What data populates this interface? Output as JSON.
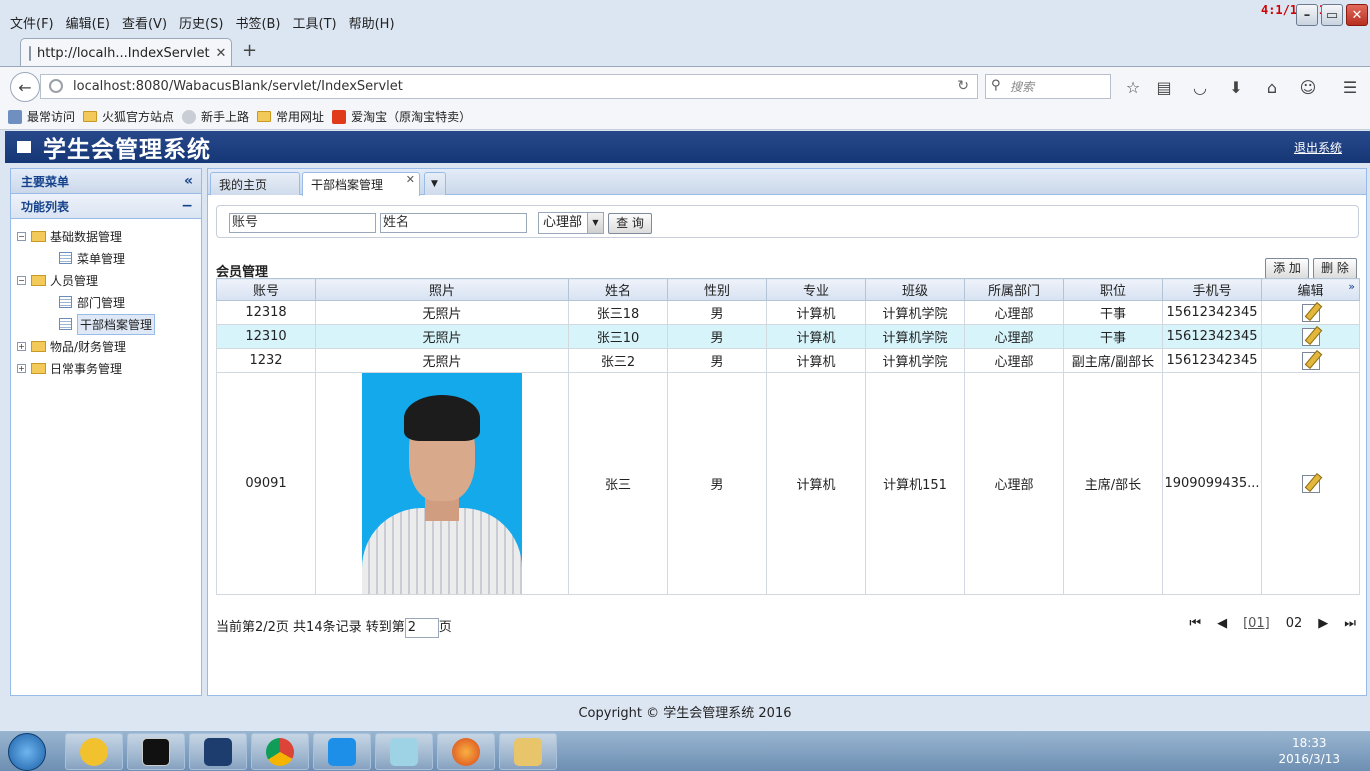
{
  "browser": {
    "menu": [
      "文件(F)",
      "编辑(E)",
      "查看(V)",
      "历史(S)",
      "书签(B)",
      "工具(T)",
      "帮助(H)"
    ],
    "timer": "4:1/16:21",
    "tab_title": "http://localh...IndexServlet",
    "url": "localhost:8080/WabacusBlank/servlet/IndexServlet",
    "search_placeholder": "搜索",
    "bookmarks": [
      "最常访问",
      "火狐官方站点",
      "新手上路",
      "常用网址",
      "爱淘宝（原淘宝特卖）"
    ]
  },
  "app": {
    "title": "学生会管理系统",
    "logout": "退出系统"
  },
  "sidebar": {
    "header": "主要菜单",
    "section": "功能列表",
    "tree": [
      {
        "label": "基础数据管理",
        "children": [
          "菜单管理"
        ]
      },
      {
        "label": "人员管理",
        "children": [
          "部门管理",
          "干部档案管理"
        ]
      },
      {
        "label": "物品/财务管理",
        "children": []
      },
      {
        "label": "日常事务管理",
        "children": []
      }
    ]
  },
  "main": {
    "tabs": [
      "我的主页",
      "干部档案管理"
    ],
    "filter": {
      "account": "账号",
      "name": "姓名",
      "dept": "心理部",
      "query": "查 询"
    },
    "grid_title": "会员管理",
    "add": "添 加",
    "delete": "删 除",
    "columns": [
      "账号",
      "照片",
      "姓名",
      "性别",
      "专业",
      "班级",
      "所属部门",
      "职位",
      "手机号",
      "编辑"
    ],
    "rows": [
      [
        "12318",
        "无照片",
        "张三18",
        "男",
        "计算机",
        "计算机学院",
        "心理部",
        "干事",
        "15612342345"
      ],
      [
        "12310",
        "无照片",
        "张三10",
        "男",
        "计算机",
        "计算机学院",
        "心理部",
        "干事",
        "15612342345"
      ],
      [
        "1232",
        "无照片",
        "张三2",
        "男",
        "计算机",
        "计算机学院",
        "心理部",
        "副主席/副部长",
        "15612342345"
      ],
      [
        "09091",
        "",
        "张三",
        "男",
        "计算机",
        "计算机151",
        "心理部",
        "主席/部长",
        "1909099435..."
      ]
    ],
    "pager": {
      "prefix": "当前第2/2页 共14条记录 转到第",
      "page": "2",
      "suffix": "页",
      "link1": "[01]",
      "current": "02"
    }
  },
  "footer": "Copyright © 学生会管理系统 2016",
  "taskbar": {
    "time": "18:33",
    "date": "2016/3/13"
  }
}
